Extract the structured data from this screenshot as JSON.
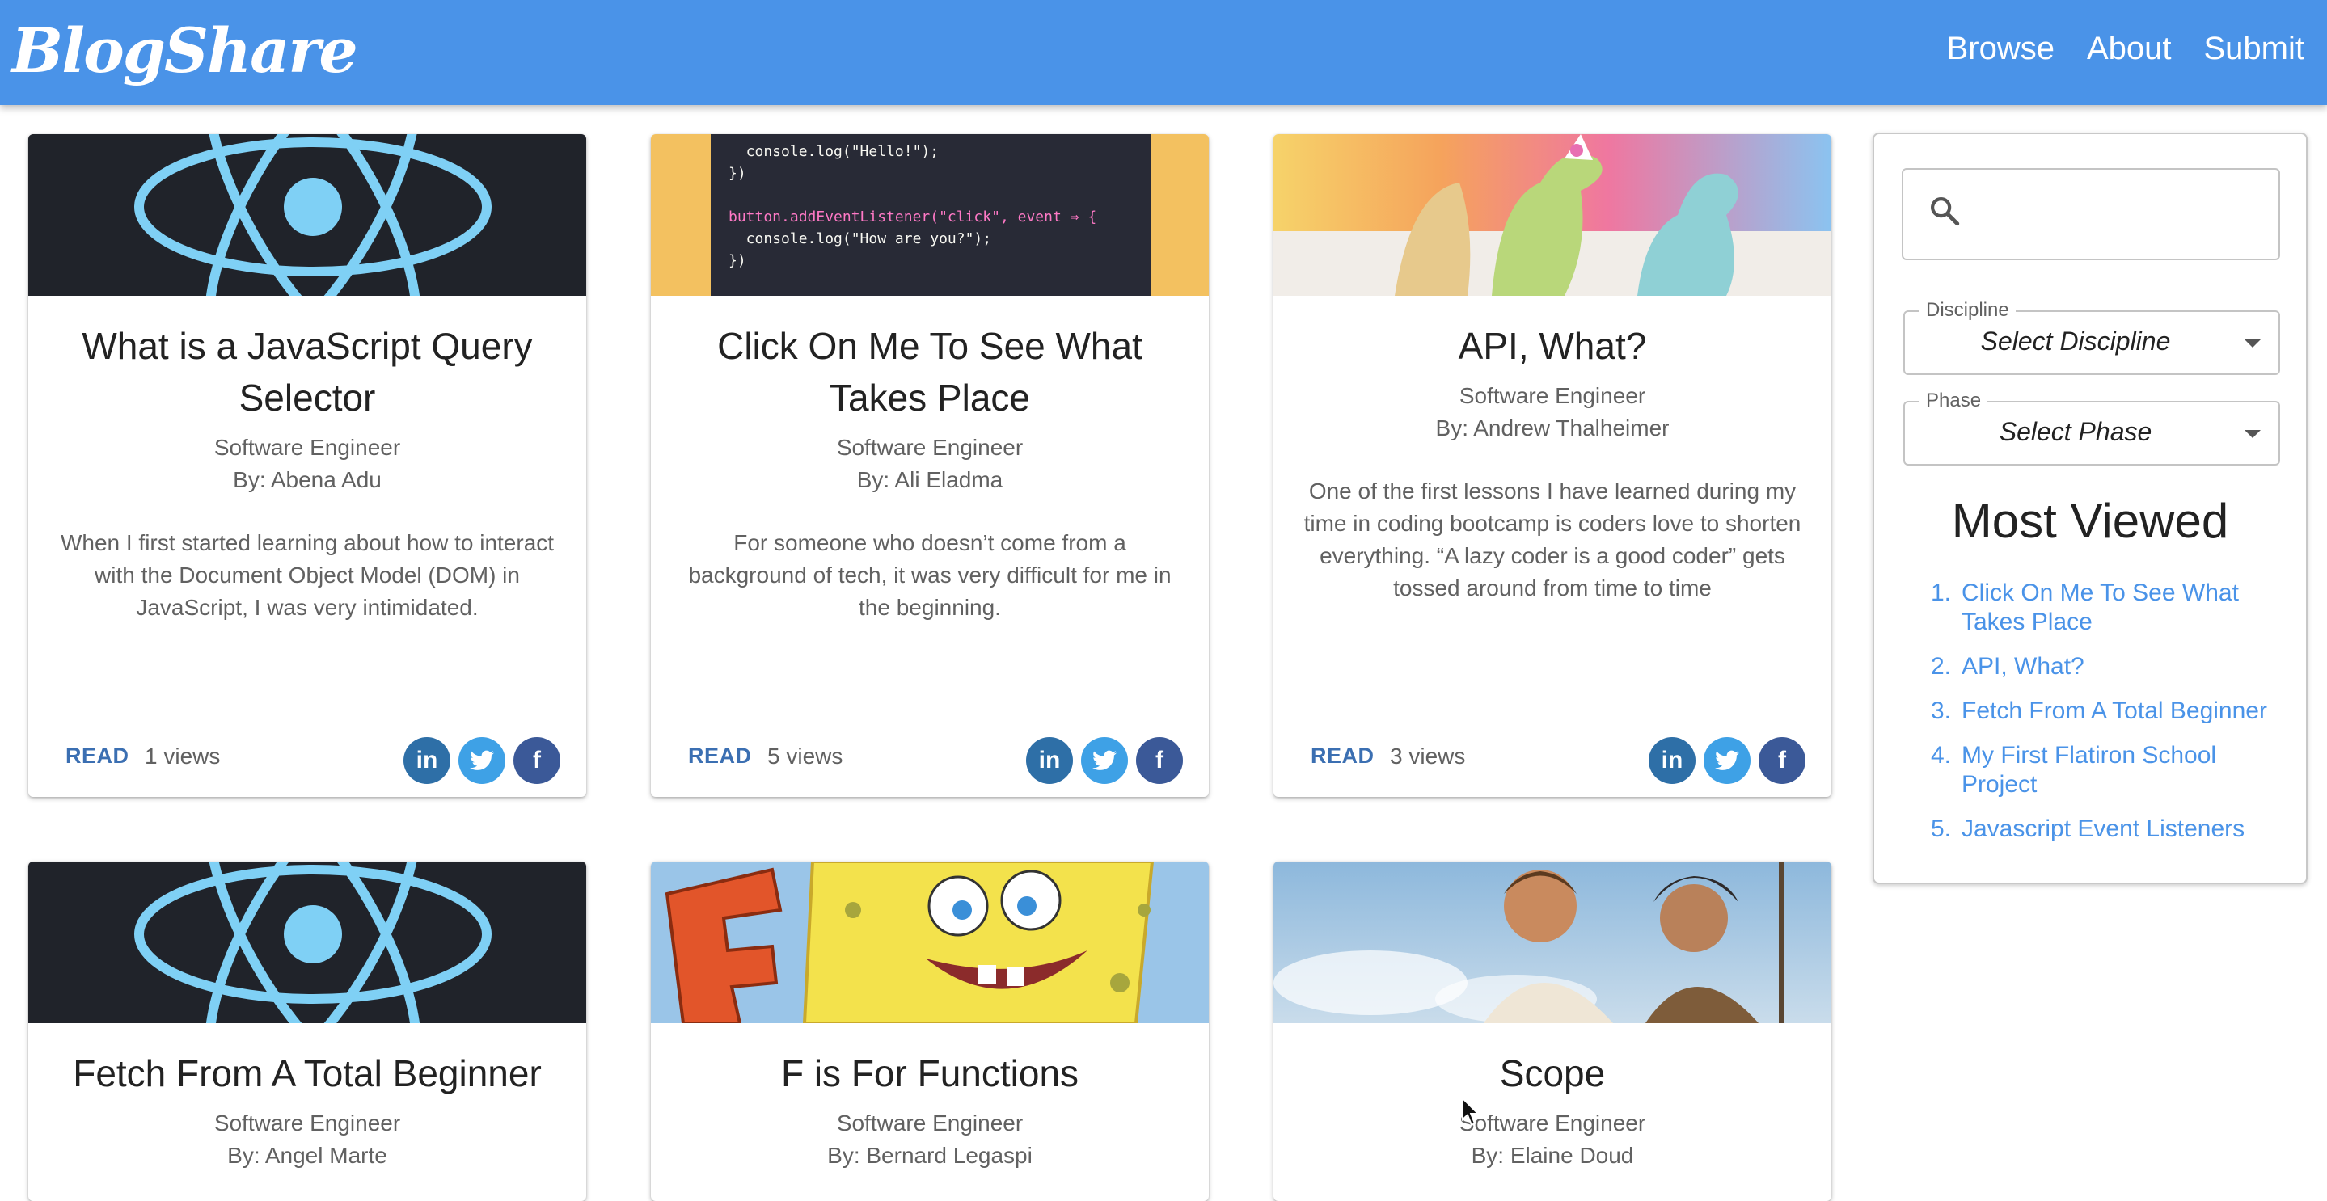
{
  "app": {
    "logo": "BlogShare",
    "nav": [
      "Browse",
      "About",
      "Submit"
    ]
  },
  "cards": [
    {
      "title": "What is a JavaScript Query Selector",
      "discipline": "Software Engineer",
      "author": "By: Abena Adu",
      "excerpt": "When I first started learning about how to interact with the Document Object Model (DOM) in JavaScript, I was very intimidated.",
      "read_label": "READ",
      "views": "1 views",
      "image": "react-logo"
    },
    {
      "title": "Click On Me To See What Takes Place",
      "discipline": "Software Engineer",
      "author": "By: Ali Eladma",
      "excerpt": "For someone who doesn’t come from a background of tech, it was very difficult for me in the beginning.",
      "read_label": "READ",
      "views": "5 views",
      "image": "code-snippet",
      "code_lines": [
        "  console.log(\"Hello!\");",
        "})",
        "",
        "button.addEventListener(\"click\", event ⇒ {",
        "  console.log(\"How are you?\");",
        "})"
      ]
    },
    {
      "title": "API, What?",
      "discipline": "Software Engineer",
      "author": "By: Andrew Thalheimer",
      "excerpt": "One of the first lessons I have learned during my time in coding bootcamp is coders love to shorten everything. “A lazy coder is a good coder” gets tossed around from time to time",
      "read_label": "READ",
      "views": "3 views",
      "image": "toy-dinosaurs"
    },
    {
      "title": "Fetch From A Total Beginner",
      "discipline": "Software Engineer",
      "author": "By: Angel Marte",
      "image": "react-logo"
    },
    {
      "title": "F is For Functions",
      "discipline": "Software Engineer",
      "author": "By: Bernard Legaspi",
      "image": "spongebob-f"
    },
    {
      "title": "Scope",
      "discipline": "Software Engineer",
      "author": "By: Elaine Doud",
      "image": "animated-characters"
    }
  ],
  "sidebar": {
    "search_placeholder": "",
    "discipline_label": "Discipline",
    "discipline_value": "Select Discipline",
    "phase_label": "Phase",
    "phase_value": "Select Phase",
    "most_viewed_title": "Most Viewed",
    "most_viewed": [
      {
        "num": "1.",
        "title": "Click On Me To See What Takes Place"
      },
      {
        "num": "2.",
        "title": "API, What?"
      },
      {
        "num": "3.",
        "title": "Fetch From A Total Beginner"
      },
      {
        "num": "4.",
        "title": "My First Flatiron School Project"
      },
      {
        "num": "5.",
        "title": "Javascript Event Listeners"
      }
    ]
  },
  "colors": {
    "appbar": "#4a93e8",
    "link": "#4a93e8",
    "linkedin": "#2e6fa7",
    "twitter": "#3ea1e6",
    "facebook": "#3b5998"
  }
}
